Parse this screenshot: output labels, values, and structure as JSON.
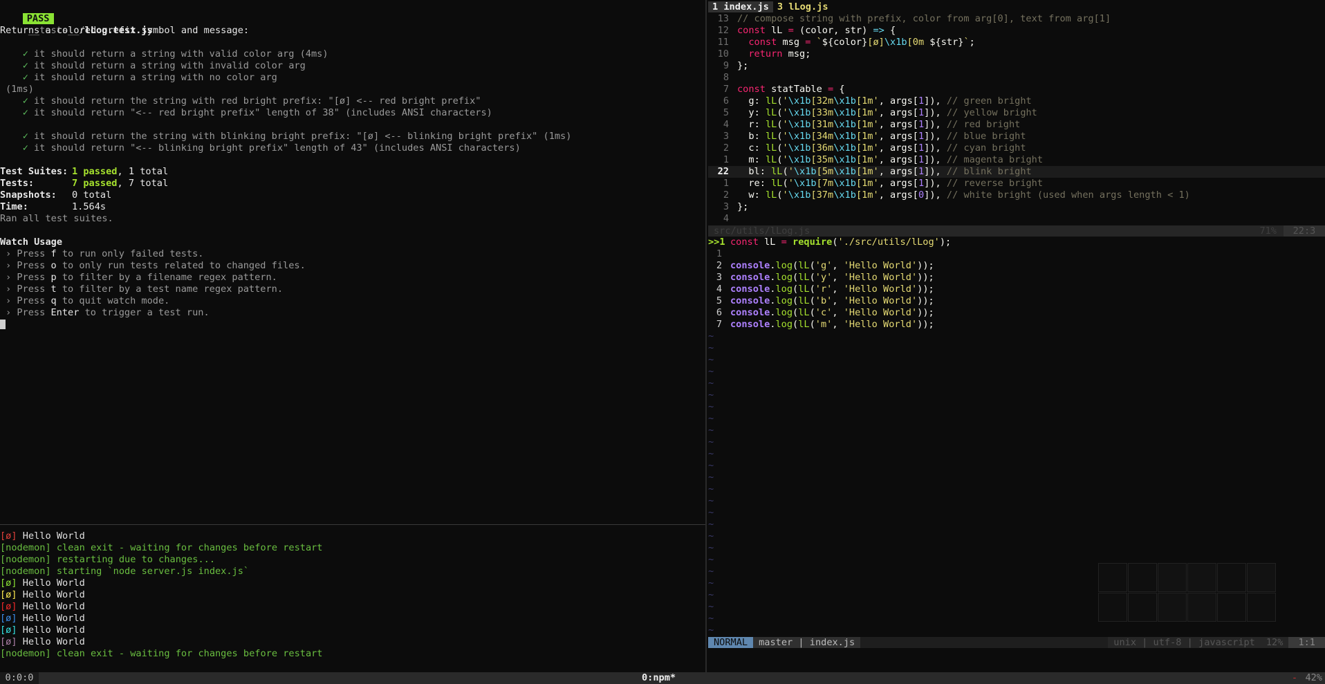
{
  "test_pane": {
    "pass_badge": "PASS",
    "file_dir": "__tests__/",
    "file_name": "lLog.test.js",
    "describe": "Returns a colored prefix symbol and message:",
    "tests": [
      {
        "check": "✓",
        "text": "it should return a string with valid color arg (4ms)"
      },
      {
        "check": "✓",
        "text": "it should return a string with invalid color arg"
      },
      {
        "check": "✓",
        "text": "it should return a string with no color arg"
      },
      {
        "check": "",
        "text": "(1ms)"
      },
      {
        "check": "✓",
        "text": "it should return the string with red bright prefix: \"[ø] <-- red bright prefix\""
      },
      {
        "check": "✓",
        "text": "it should return \"<-- red bright prefix\" length of 38\" (includes ANSI characters)"
      },
      {
        "check": "✓",
        "text": "it should return the string with blinking bright prefix: \"[ø] <-- blinking bright prefix\" (1ms)"
      },
      {
        "check": "✓",
        "text": "it should return \"<-- blinking bright prefix\" length of 43\" (includes ANSI characters)"
      }
    ],
    "summary": {
      "suites_label": "Test Suites:",
      "suites_passed": "1 passed",
      "suites_total": ", 1 total",
      "tests_label": "Tests:",
      "tests_passed": "7 passed",
      "tests_total": ", 7 total",
      "snapshots_label": "Snapshots:",
      "snapshots_value": "0 total",
      "time_label": "Time:",
      "time_value": "1.564s",
      "ran": "Ran all test suites."
    },
    "watch": {
      "title": "Watch Usage",
      "items": [
        {
          "pre": "› Press ",
          "key": "f",
          "post": " to run only failed tests."
        },
        {
          "pre": "› Press ",
          "key": "o",
          "post": " to only run tests related to changed files."
        },
        {
          "pre": "› Press ",
          "key": "p",
          "post": " to filter by a filename regex pattern."
        },
        {
          "pre": "› Press ",
          "key": "t",
          "post": " to filter by a test name regex pattern."
        },
        {
          "pre": "› Press ",
          "key": "q",
          "post": " to quit watch mode."
        },
        {
          "pre": "› Press ",
          "key": "Enter",
          "post": " to trigger a test run."
        }
      ]
    }
  },
  "nodemon_pane": {
    "lines": [
      {
        "prefix": "[ø]",
        "prefix_color": "#e0403a",
        "text": " Hello World",
        "text_color": "#e0e0e0"
      },
      {
        "prefix": "",
        "prefix_color": "",
        "text": "[nodemon] clean exit - waiting for changes before restart",
        "text_color": "#6abf40"
      },
      {
        "prefix": "",
        "prefix_color": "",
        "text": "[nodemon] restarting due to changes...",
        "text_color": "#6abf40"
      },
      {
        "prefix": "",
        "prefix_color": "",
        "text": "[nodemon] starting `node server.js index.js`",
        "text_color": "#6abf40"
      },
      {
        "prefix": "[ø]",
        "prefix_color": "#8ae234",
        "text": " Hello World",
        "text_color": "#e0e0e0"
      },
      {
        "prefix": "[ø]",
        "prefix_color": "#fce94f",
        "text": " Hello World",
        "text_color": "#e0e0e0"
      },
      {
        "prefix": "[ø]",
        "prefix_color": "#ef2929",
        "text": " Hello World",
        "text_color": "#e0e0e0"
      },
      {
        "prefix": "[ø]",
        "prefix_color": "#3b8eea",
        "text": " Hello World",
        "text_color": "#e0e0e0"
      },
      {
        "prefix": "[ø]",
        "prefix_color": "#34e2e2",
        "text": " Hello World",
        "text_color": "#e0e0e0"
      },
      {
        "prefix": "[ø]",
        "prefix_color": "#ad7fa8",
        "text": " Hello World",
        "text_color": "#e0e0e0"
      },
      {
        "prefix": "",
        "prefix_color": "",
        "text": "[nodemon] clean exit - waiting for changes before restart",
        "text_color": "#6abf40"
      }
    ]
  },
  "editor": {
    "tabs": [
      {
        "label": "1 index.js",
        "active": true
      },
      {
        "label": "3 lLog.js",
        "active": false
      }
    ],
    "top_numbers": [
      "13",
      "12",
      "11",
      "10",
      "9",
      "8",
      "7",
      "6",
      "5",
      "4",
      "3",
      "2",
      "1",
      "22",
      "1",
      "2",
      "3",
      "4"
    ],
    "stat_keys": [
      "g",
      "y",
      "r",
      "b",
      "c",
      "m",
      "bl",
      "re",
      "w"
    ],
    "stat_codes": [
      "32m",
      "33m",
      "31m",
      "34m",
      "36m",
      "35m",
      "5m",
      "7m",
      "37m"
    ],
    "stat_args": [
      "1",
      "1",
      "1",
      "1",
      "1",
      "1",
      "1",
      "1",
      "0"
    ],
    "stat_comments": [
      "// green bright",
      "// yellow bright",
      "// red bright",
      "// blue bright",
      "// cyan bright",
      "// magenta bright",
      "// blink bright",
      "// reverse bright",
      "// white bright (used when args length < 1)"
    ],
    "line13_comment": "// compose string with prefix, color from arg[0], text from arg[1]",
    "inactive_status_left": "src/utils/lLog.js",
    "inactive_status_pct": "71%",
    "inactive_status_pos": "22:3",
    "bottom_numbers": [
      ">>1",
      "1",
      "2",
      "3",
      "4",
      "5",
      "6",
      "7"
    ],
    "require_path": "'./src/utils/lLog'",
    "log_args": [
      "'g'",
      "'y'",
      "'r'",
      "'b'",
      "'c'",
      "'m'"
    ],
    "hello": "'Hello World'",
    "statusline": {
      "mode": "NORMAL",
      "branch_file": "master | index.js",
      "right": "unix | utf-8 | javascript",
      "pct": "12%",
      "pos": "1:1"
    }
  },
  "tmux": {
    "left": "0:0:0",
    "center": "0:npm*",
    "right_dash": "-",
    "right_pct": "42%"
  }
}
